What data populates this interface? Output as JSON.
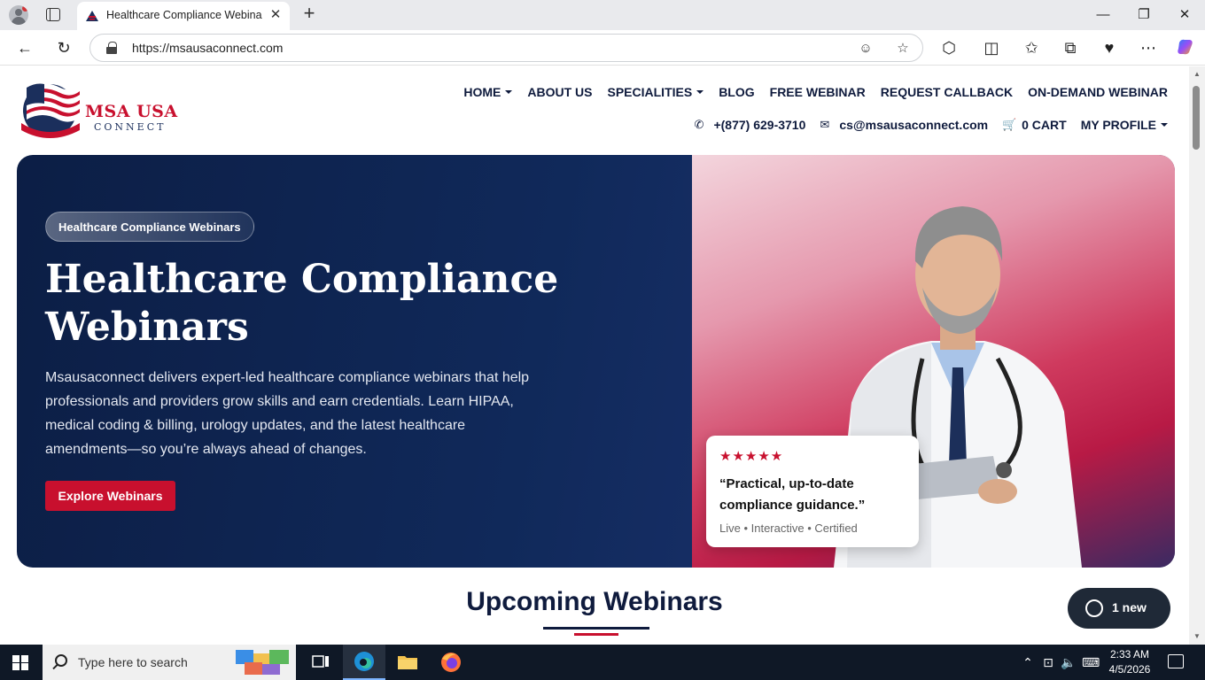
{
  "browser": {
    "tab_title": "Healthcare Compliance Webinars",
    "tab_close": "✕",
    "new_tab": "+",
    "url": "https://msausaconnect.com",
    "window_controls": {
      "minimize": "—",
      "restore": "❐",
      "close": "✕"
    },
    "toolbar_icons": [
      "back-icon",
      "refresh-icon",
      "read-aloud-icon",
      "favorite-star-icon",
      "extensions-icon",
      "split-screen-icon",
      "favorites-icon",
      "collections-icon",
      "browser-essentials-icon",
      "more-icon",
      "copilot-icon"
    ]
  },
  "site": {
    "logo_name": "MSA USA",
    "logo_sub": "CONNECT",
    "nav": [
      {
        "label": "HOME",
        "dropdown": true
      },
      {
        "label": "ABOUT US",
        "dropdown": false
      },
      {
        "label": "SPECIALITIES",
        "dropdown": true
      },
      {
        "label": "BLOG",
        "dropdown": false
      },
      {
        "label": "FREE WEBINAR",
        "dropdown": false
      },
      {
        "label": "REQUEST CALLBACK",
        "dropdown": false
      },
      {
        "label": "ON-DEMAND WEBINAR",
        "dropdown": false
      }
    ],
    "contact": {
      "phone": "+(877) 629-3710",
      "email": "cs@msausaconnect.com",
      "cart": "0 CART",
      "profile": "MY PROFILE"
    }
  },
  "hero": {
    "badge": "Healthcare Compliance Webinars",
    "title": "Healthcare Compliance Webinars",
    "description": "Msausaconnect delivers expert-led healthcare compliance webinars that help professionals and providers grow skills and earn credentials. Learn HIPAA, medical coding & billing, urology updates, and the latest healthcare amendments—so you’re always ahead of changes.",
    "cta": "Explore Webinars",
    "review": {
      "rating": 5,
      "stars": "★★★★★",
      "quote": "“Practical, up-to-date compliance guidance.”",
      "tags": "Live • Interactive • Certified"
    }
  },
  "section": {
    "title": "Upcoming Webinars"
  },
  "chat": {
    "label": "1 new"
  },
  "taskbar": {
    "search_placeholder": "Type here to search",
    "time": "2:33 AM",
    "date": "4/5/2026"
  },
  "colors": {
    "brand_red": "#c8102e",
    "brand_navy": "#0f1b3d"
  }
}
